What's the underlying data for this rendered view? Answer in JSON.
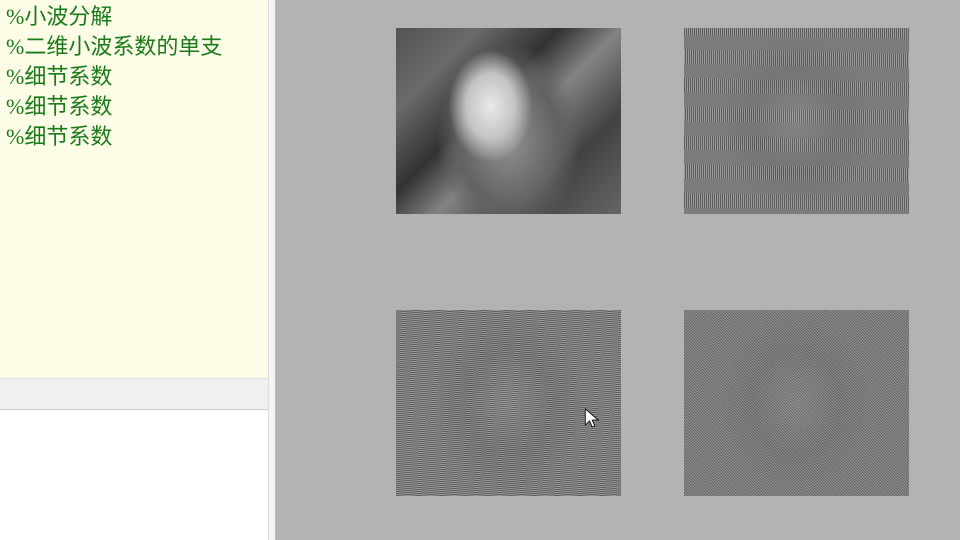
{
  "editor": {
    "lines": [
      "%小波分解",
      "%二维小波系数的单支",
      "%细节系数",
      "%细节系数",
      "%细节系数"
    ]
  },
  "figures": {
    "topLeft": {
      "name": "approximation-image"
    },
    "topRight": {
      "name": "horizontal-detail-image"
    },
    "botLeft": {
      "name": "vertical-detail-image"
    },
    "botRight": {
      "name": "diagonal-detail-image"
    }
  }
}
